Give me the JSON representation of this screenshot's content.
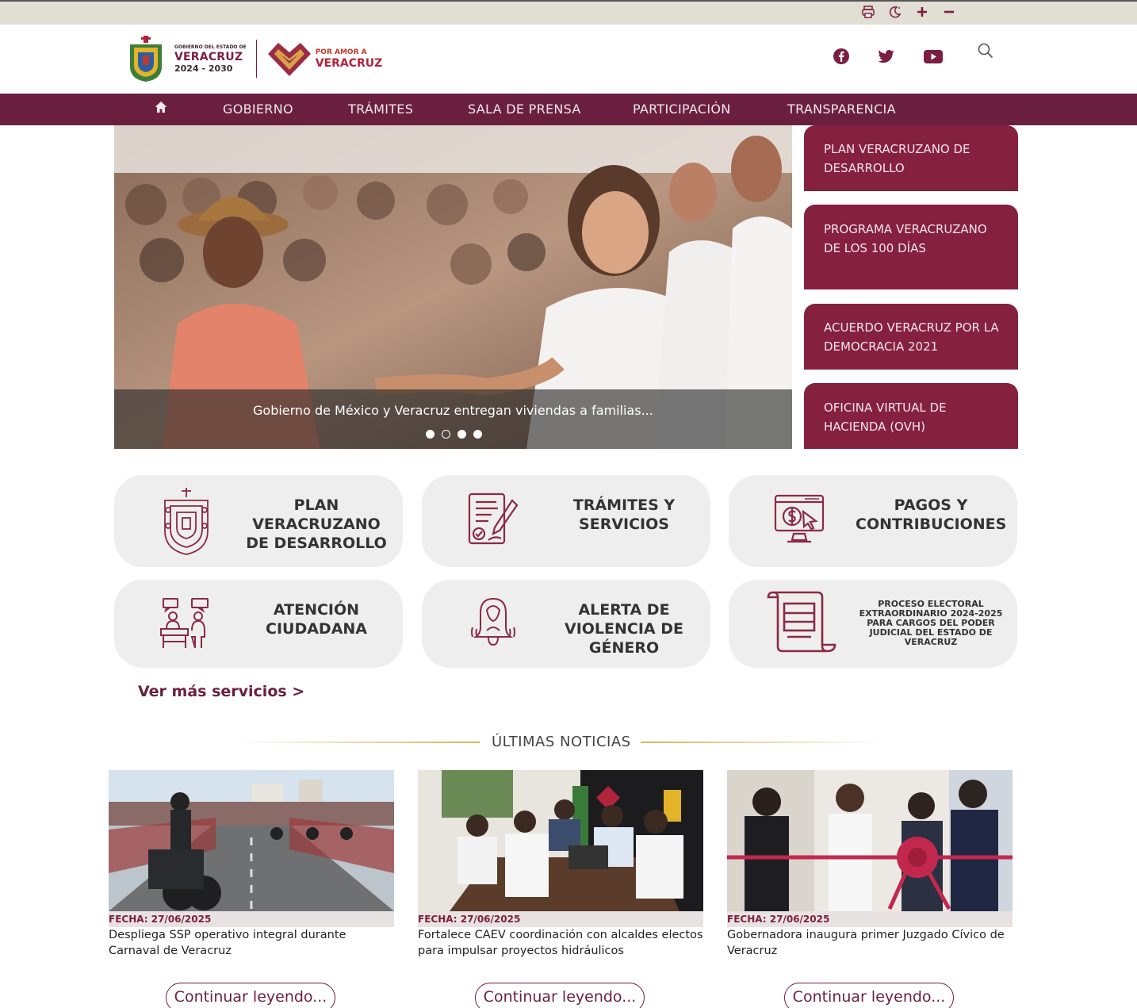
{
  "utility": {
    "icons": [
      "print-icon",
      "dark-mode-icon",
      "zoom-in-icon",
      "zoom-out-icon"
    ]
  },
  "brand": {
    "gov_small": "GOBIERNO DEL ESTADO DE",
    "gov_big": "VERACRUZ",
    "gov_years": "2024 - 2030",
    "amor_small": "POR AMOR A",
    "amor_big": "VERACRUZ"
  },
  "social": [
    "facebook-icon",
    "twitter-icon",
    "youtube-icon",
    "search-icon"
  ],
  "nav": {
    "home_icon": "home-icon",
    "items": [
      "GOBIERNO",
      "TRÁMITES",
      "SALA DE PRENSA",
      "PARTICIPACIÓN",
      "TRANSPARENCIA"
    ]
  },
  "hero": {
    "caption": "Gobierno de México y Veracruz entregan viviendas a familias...",
    "slides": 4,
    "active_slide": 2
  },
  "side_buttons": [
    "PLAN VERACRUZANO DE DESARROLLO",
    "PROGRAMA VERACRUZANO DE LOS 100 DÍAS",
    "ACUERDO VERACRUZ POR LA DEMOCRACIA 2021",
    "OFICINA VIRTUAL DE HACIENDA (OVH)"
  ],
  "services": [
    {
      "label": "PLAN VERACRUZANO DE DESARROLLO",
      "icon": "state-shield-icon"
    },
    {
      "label": "TRÁMITES Y SERVICIOS",
      "icon": "form-signing-icon"
    },
    {
      "label": "PAGOS Y CONTRIBUCIONES",
      "icon": "online-payment-icon"
    },
    {
      "label": "ATENCIÓN CIUDADANA",
      "icon": "service-desk-icon"
    },
    {
      "label": "ALERTA DE VIOLENCIA DE GÉNERO",
      "icon": "alarm-bell-woman-icon"
    },
    {
      "label": "PROCESO ELECTORAL EXTRAORDINARIO 2024-2025 PARA CARGOS DEL PODER JUDICIAL DEL ESTADO DE VERACRUZ",
      "icon": "scroll-document-icon"
    }
  ],
  "more_services": "Ver más servicios >",
  "news_header": "ÚLTIMAS NOTICIAS",
  "news": [
    {
      "date": "FECHA: 27/06/2025",
      "title": "Despliega SSP operativo integral durante Carnaval de Veracruz",
      "cta": "Continuar leyendo..."
    },
    {
      "date": "FECHA: 27/06/2025",
      "title": "Fortalece CAEV coordinación con alcaldes electos para impulsar proyectos hidráulicos",
      "cta": "Continuar leyendo..."
    },
    {
      "date": "FECHA: 27/06/2025",
      "title": "Gobernadora inaugura primer Juzgado Cívico de Veracruz",
      "cta": "Continuar leyendo..."
    }
  ],
  "colors": {
    "brand": "#6b1f3f",
    "button": "#86203f",
    "gold": "#d6b45a",
    "card_bg": "#eeeeee"
  }
}
